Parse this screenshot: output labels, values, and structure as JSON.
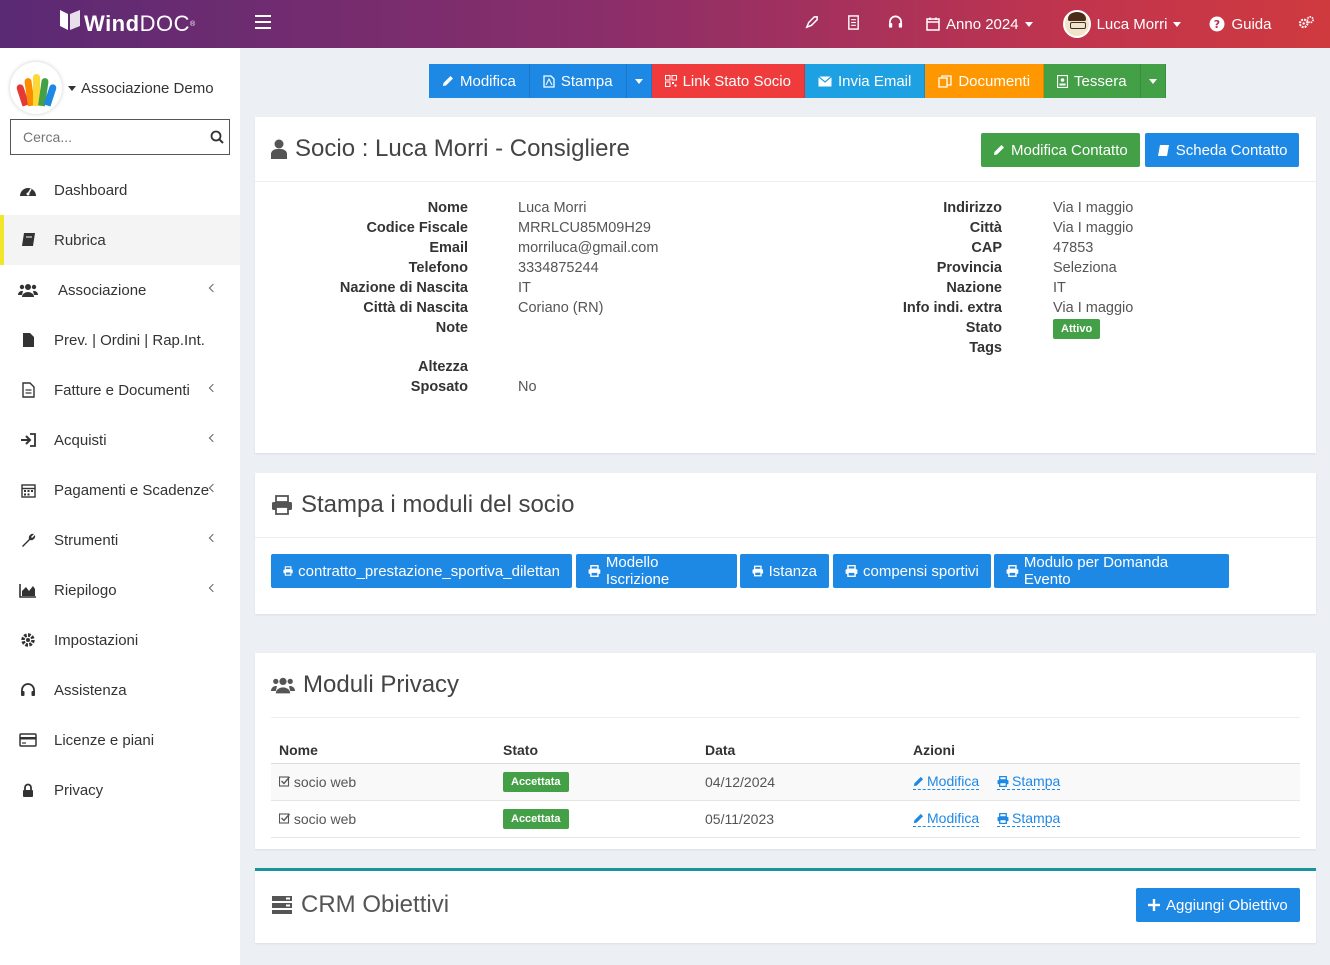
{
  "app": {
    "logo_bold": "Wind",
    "logo_light": "DOC",
    "logo_reg": "®"
  },
  "topbar": {
    "year_label": "Anno 2024",
    "user_name": "Luca Morri",
    "help_label": "Guida"
  },
  "sidebar": {
    "org_name": "Associazione Demo",
    "search_placeholder": "Cerca...",
    "items": [
      {
        "label": "Dashboard",
        "icon": "dashboard-icon"
      },
      {
        "label": "Rubrica",
        "icon": "book-icon"
      },
      {
        "label": "Associazione",
        "icon": "users-icon"
      },
      {
        "label": "Prev. | Ordini | Rap.Int.",
        "icon": "file-icon"
      },
      {
        "label": "Fatture e Documenti",
        "icon": "document-icon"
      },
      {
        "label": "Acquisti",
        "icon": "sign-in-icon"
      },
      {
        "label": "Pagamenti e Scadenze",
        "icon": "calendar-icon"
      },
      {
        "label": "Strumenti",
        "icon": "wrench-icon"
      },
      {
        "label": "Riepilogo",
        "icon": "area-chart-icon"
      },
      {
        "label": "Impostazioni",
        "icon": "gear-icon"
      },
      {
        "label": "Assistenza",
        "icon": "headset-icon"
      },
      {
        "label": "Licenze e piani",
        "icon": "credit-card-icon"
      },
      {
        "label": "Privacy",
        "icon": "lock-icon"
      }
    ]
  },
  "toolbar": {
    "modifica": "Modifica",
    "stampa": "Stampa",
    "link_stato": "Link Stato Socio",
    "invia_email": "Invia Email",
    "documenti": "Documenti",
    "tessera": "Tessera"
  },
  "socio": {
    "title": "Socio : Luca Morri - Consigliere",
    "btn_modifica": "Modifica Contatto",
    "btn_scheda": "Scheda Contatto",
    "left_labels": [
      "Nome",
      "Codice Fiscale",
      "Email",
      "Telefono",
      "Nazione di Nascita",
      "Città di Nascita",
      "Note"
    ],
    "left_values": [
      "Luca Morri",
      "MRRLCU85M09H29",
      "morriluca@gmail.com",
      "3334875244",
      "IT",
      "Coriano (RN)",
      ""
    ],
    "extra_labels": [
      "Altezza",
      "Sposato"
    ],
    "extra_values": [
      "",
      "No"
    ],
    "right_labels": [
      "Indirizzo",
      "Città",
      "CAP",
      "Provincia",
      "Nazione",
      "Info indi. extra",
      "Stato",
      "Tags"
    ],
    "right_values": [
      "Via I maggio",
      "Via I maggio",
      "47853",
      "Seleziona",
      "IT",
      "Via I maggio"
    ],
    "stato_badge": "Attivo"
  },
  "moduli": {
    "title": "Stampa i moduli del socio",
    "buttons": [
      "contratto_prestazione_sportiva_dilettan",
      "Modello Iscrizione",
      "Istanza",
      "compensi sportivi",
      "Modulo per Domanda Evento"
    ]
  },
  "privacy": {
    "title": "Moduli Privacy",
    "headers": [
      "Nome",
      "Stato",
      "Data",
      "Azioni"
    ],
    "rows": [
      {
        "nome": "socio web",
        "stato": "Accettata",
        "data": "04/12/2024",
        "azione1": "Modifica",
        "azione2": "Stampa"
      },
      {
        "nome": "socio web",
        "stato": "Accettata",
        "data": "05/11/2023",
        "azione1": "Modifica",
        "azione2": "Stampa"
      }
    ]
  },
  "crm": {
    "title": "CRM Obiettivi",
    "btn_add": "Aggiungi Obiettivo"
  },
  "colors": {
    "accent_blue": "#1e88e5",
    "green": "#43a047",
    "red": "#ef3b3b",
    "orange": "#ff9800",
    "cyan": "#1da1e3",
    "teal_border": "#17959a",
    "active_marker": "#f0e62a"
  }
}
